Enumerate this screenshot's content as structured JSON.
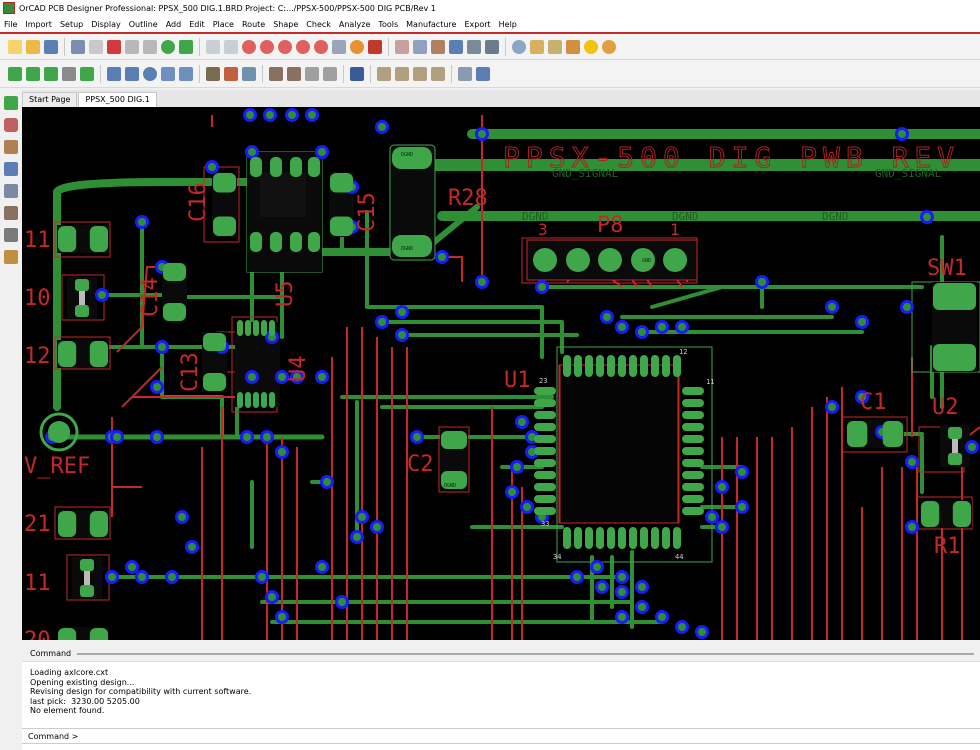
{
  "window": {
    "title": "OrCAD PCB Designer Professional: PPSX_500 DIG.1.BRD  Project: C:.../PPSX-500/PPSX-500 DIG PCB/Rev 1"
  },
  "menu": [
    "File",
    "Import",
    "Setup",
    "Display",
    "Outline",
    "Add",
    "Edit",
    "Place",
    "Route",
    "Shape",
    "Check",
    "Analyze",
    "Tools",
    "Manufacture",
    "Export",
    "Help"
  ],
  "tabs": [
    {
      "label": "Start Page"
    },
    {
      "label": "PPSX_500 DIG.1"
    }
  ],
  "board": {
    "title_text": "PPSX-500 DIG PWB REV",
    "net_labels": [
      "GND_SIGNAL",
      "GND_SIGNAL",
      "DGND",
      "DGND",
      "DGND"
    ],
    "refdes": [
      "R28",
      "P8",
      "U1",
      "C16",
      "C15",
      "C14",
      "C13",
      "U5",
      "U4",
      "C2",
      "C1",
      "U2",
      "R1",
      "SW1",
      "V_REF",
      "11",
      "10",
      "12",
      "21",
      "11",
      "20"
    ],
    "pin_labels": [
      "3",
      "1",
      "23",
      "12",
      "11",
      "33",
      "34",
      "44"
    ],
    "pad_labels": [
      "DGND",
      "DGND",
      "GND",
      "DGND"
    ],
    "colors": {
      "trace": "#2f8f35",
      "etch": "#c62828",
      "via": "#1a1aff",
      "pad": "#3fa64a",
      "background": "#000000"
    }
  },
  "command": {
    "header": "Command",
    "log": [
      "Loading axlcore.cxt",
      "Opening existing design...",
      "Revising design for compatibility with current software.",
      "last pick:  3230.00 5205.00",
      "No element found."
    ],
    "prompt_label": "Command >",
    "input_value": ""
  }
}
